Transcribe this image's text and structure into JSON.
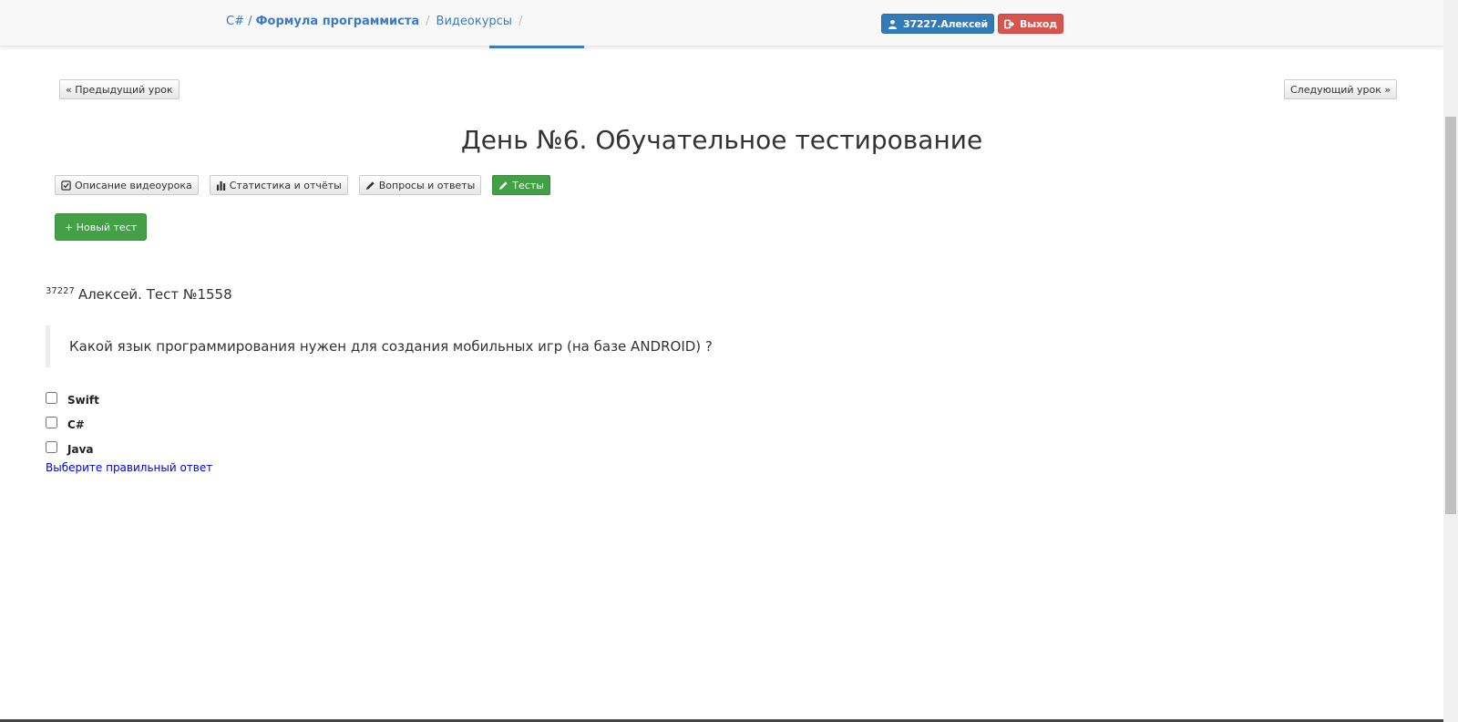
{
  "header": {
    "breadcrumb": {
      "course_prefix": "C#",
      "course_name": "Формула программиста",
      "section": "Видеокурсы"
    },
    "user_button": "37227.Алексей",
    "exit_button": "Выход",
    "user_icon": "user-icon",
    "exit_icon": "logout-icon"
  },
  "lesson_nav": {
    "prev_label": "« Предыдущий урок",
    "next_label": "Следующий урок »"
  },
  "page_title": "День №6. Обучательное тестирование",
  "tabs": [
    {
      "label": "Описание видеоурока",
      "icon": "check-square-icon",
      "active": false
    },
    {
      "label": "Статистика и отчёты",
      "icon": "bar-chart-icon",
      "active": false
    },
    {
      "label": "Вопросы и ответы",
      "icon": "pencil-icon",
      "active": false
    },
    {
      "label": "Тесты",
      "icon": "pencil-icon",
      "active": true
    }
  ],
  "new_test_button": "+ Новый тест",
  "test": {
    "user_id": "37227",
    "title": "Алексей. Тест №1558",
    "question": "Какой язык программирования нужен для создания мобильных игр (на базе ANDROID) ?",
    "answers": [
      {
        "label": "Swift",
        "checked": false
      },
      {
        "label": "C#",
        "checked": false
      },
      {
        "label": "Java",
        "checked": false
      }
    ],
    "hint": "Выберите правильный ответ"
  },
  "colors": {
    "primary": "#337ab7",
    "danger": "#d9534f",
    "success": "#44a046",
    "link": "#3b7bbf"
  }
}
